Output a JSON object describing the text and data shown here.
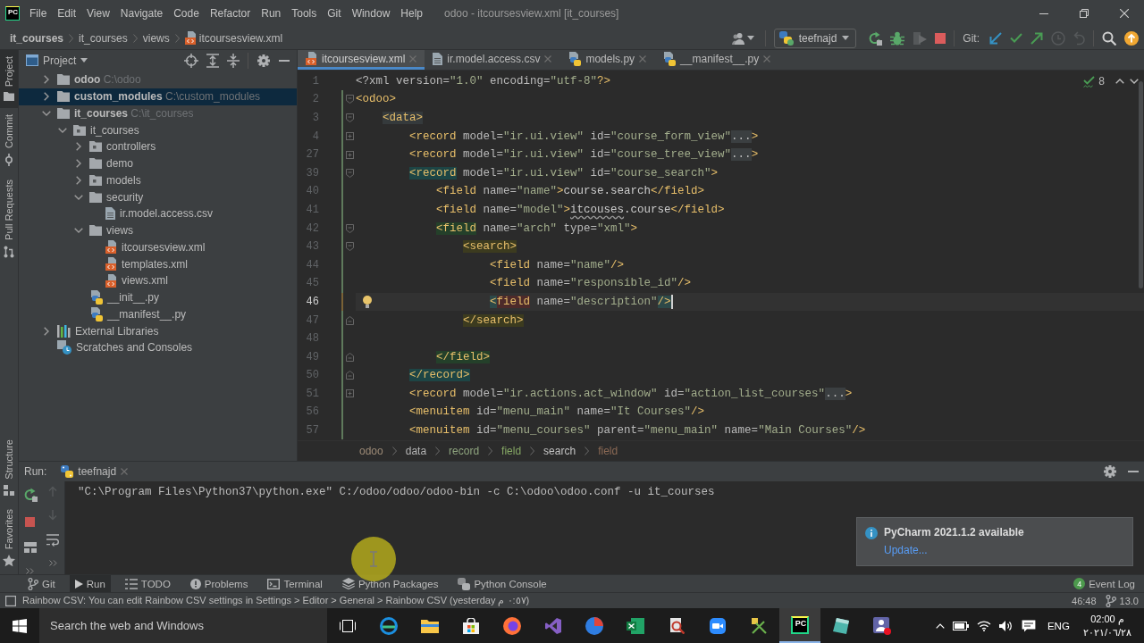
{
  "title_bar": {
    "logo": "PC",
    "menu": [
      "File",
      "Edit",
      "View",
      "Navigate",
      "Code",
      "Refactor",
      "Run",
      "Tools",
      "Git",
      "Window",
      "Help"
    ],
    "title": "odoo - itcoursesview.xml [it_courses]"
  },
  "nav_bar": {
    "breadcrumbs": [
      {
        "label": "it_courses",
        "kind": "root"
      },
      {
        "label": "it_courses",
        "kind": "folder"
      },
      {
        "label": "views",
        "kind": "folder"
      },
      {
        "label": "itcoursesview.xml",
        "kind": "xml"
      }
    ],
    "run_config": "teefnajd",
    "git_label": "Git:"
  },
  "tool_stripe": {
    "top": [
      {
        "label": "Project",
        "kind": "project",
        "selected": true
      },
      {
        "label": "Commit",
        "kind": "commit",
        "selected": false
      },
      {
        "label": "Pull Requests",
        "kind": "pulls",
        "selected": false
      }
    ],
    "bottom": [
      {
        "label": "Structure",
        "kind": "structure",
        "selected": false
      },
      {
        "label": "Favorites",
        "kind": "favorites",
        "selected": false
      }
    ]
  },
  "project_panel": {
    "title": "Project",
    "tree": [
      {
        "label": "odoo",
        "path": "C:\\odoo",
        "kind": "root",
        "expanded": false,
        "selected": false
      },
      {
        "label": "custom_modules",
        "path": "C:\\custom_modules",
        "kind": "root",
        "expanded": false,
        "selected": true
      },
      {
        "label": "it_courses",
        "path": "C:\\it_courses",
        "kind": "root",
        "expanded": true,
        "selected": false,
        "children": [
          {
            "label": "it_courses",
            "kind": "package",
            "expanded": true,
            "selected": false,
            "children": [
              {
                "label": "controllers",
                "kind": "package",
                "expanded": false,
                "selected": false
              },
              {
                "label": "demo",
                "kind": "folder",
                "expanded": false,
                "selected": false
              },
              {
                "label": "models",
                "kind": "package",
                "expanded": false,
                "selected": false
              },
              {
                "label": "security",
                "kind": "folder",
                "expanded": true,
                "selected": false,
                "children": [
                  {
                    "label": "ir.model.access.csv",
                    "kind": "csv",
                    "selected": false
                  }
                ]
              },
              {
                "label": "views",
                "kind": "folder",
                "expanded": true,
                "selected": false,
                "children": [
                  {
                    "label": "itcoursesview.xml",
                    "kind": "xml",
                    "selected": false
                  },
                  {
                    "label": "templates.xml",
                    "kind": "xml",
                    "selected": false
                  },
                  {
                    "label": "views.xml",
                    "kind": "xml",
                    "selected": false
                  }
                ]
              },
              {
                "label": "__init__.py",
                "kind": "python",
                "selected": false
              },
              {
                "label": "__manifest__.py",
                "kind": "python",
                "selected": false
              }
            ]
          }
        ]
      },
      {
        "label": "External Libraries",
        "kind": "libraries",
        "expanded": false,
        "selected": false
      },
      {
        "label": "Scratches and Consoles",
        "kind": "scratches",
        "selected": false
      }
    ]
  },
  "editor": {
    "tabs": [
      {
        "label": "itcoursesview.xml",
        "kind": "xml",
        "selected": true
      },
      {
        "label": "ir.model.access.csv",
        "kind": "csv",
        "selected": false
      },
      {
        "label": "models.py",
        "kind": "python",
        "selected": false
      },
      {
        "label": "__manifest__.py",
        "kind": "python",
        "selected": false
      }
    ],
    "inspections": "8",
    "lines": [
      {
        "number": "1",
        "changed": false,
        "block_end": false,
        "current": false,
        "tokens": [
          {
            "kind": "attr",
            "text": "<?xml version="
          },
          {
            "kind": "str",
            "text": "\"1.0\""
          },
          {
            "kind": "attr",
            "text": " encoding="
          },
          {
            "kind": "str",
            "text": "\"utf-8\""
          },
          {
            "kind": "tag",
            "text": "?>"
          }
        ]
      },
      {
        "number": "2",
        "changed": true,
        "expanded": true,
        "block_end": false,
        "current": false,
        "tokens": [
          {
            "kind": "tag",
            "text": "<odoo>"
          }
        ]
      },
      {
        "number": "3",
        "changed": true,
        "expanded": true,
        "block_end": false,
        "current": false,
        "tokens": [
          {
            "kind": "scope1",
            "text": "    <data>"
          }
        ]
      },
      {
        "number": "4",
        "changed": true,
        "expanded": false,
        "block_end": false,
        "current": false,
        "tokens": [
          {
            "kind": "tag",
            "text": "        <record"
          },
          {
            "kind": "attr",
            "text": " model="
          },
          {
            "kind": "str",
            "text": "\"ir.ui.view\""
          },
          {
            "kind": "attr",
            "text": " id="
          },
          {
            "kind": "str",
            "text": "\"course_form_view\""
          },
          {
            "kind": "folded",
            "text": "..."
          },
          {
            "kind": "tag",
            "text": ">"
          }
        ]
      },
      {
        "number": "27",
        "changed": true,
        "expanded": false,
        "block_end": false,
        "current": false,
        "tokens": [
          {
            "kind": "tag",
            "text": "        <record"
          },
          {
            "kind": "attr",
            "text": " model="
          },
          {
            "kind": "str",
            "text": "\"ir.ui.view\""
          },
          {
            "kind": "attr",
            "text": " id="
          },
          {
            "kind": "str",
            "text": "\"course_tree_view\""
          },
          {
            "kind": "folded",
            "text": "..."
          },
          {
            "kind": "tag",
            "text": ">"
          }
        ]
      },
      {
        "number": "39",
        "changed": true,
        "expanded": true,
        "block_end": false,
        "current": false,
        "tokens": [
          {
            "kind": "scope2",
            "text": "        <record"
          },
          {
            "kind": "attr",
            "text": " model="
          },
          {
            "kind": "str",
            "text": "\"ir.ui.view\""
          },
          {
            "kind": "attr",
            "text": " id="
          },
          {
            "kind": "str",
            "text": "\"course_search\""
          },
          {
            "kind": "tag",
            "text": ">"
          }
        ]
      },
      {
        "number": "40",
        "changed": true,
        "block_end": false,
        "current": false,
        "tokens": [
          {
            "kind": "tag",
            "text": "            <field"
          },
          {
            "kind": "attr",
            "text": " name="
          },
          {
            "kind": "str",
            "text": "\"name\""
          },
          {
            "kind": "tag",
            "text": ">"
          },
          {
            "kind": "text",
            "text": "course.search"
          },
          {
            "kind": "tag",
            "text": "</field>"
          }
        ]
      },
      {
        "number": "41",
        "changed": true,
        "block_end": false,
        "current": false,
        "tokens": [
          {
            "kind": "tag",
            "text": "            <field"
          },
          {
            "kind": "attr",
            "text": " name="
          },
          {
            "kind": "str",
            "text": "\"model\""
          },
          {
            "kind": "tag",
            "text": ">"
          },
          {
            "kind": "typo",
            "text": "itcouses"
          },
          {
            "kind": "text",
            "text": ".course"
          },
          {
            "kind": "tag",
            "text": "</field>"
          }
        ]
      },
      {
        "number": "42",
        "changed": true,
        "expanded": true,
        "block_end": false,
        "current": false,
        "tokens": [
          {
            "kind": "scope3",
            "text": "            <field"
          },
          {
            "kind": "attr",
            "text": " name="
          },
          {
            "kind": "str",
            "text": "\"arch\""
          },
          {
            "kind": "attr",
            "text": " type="
          },
          {
            "kind": "str",
            "text": "\"xml\""
          },
          {
            "kind": "tag",
            "text": ">"
          }
        ]
      },
      {
        "number": "43",
        "changed": true,
        "expanded": true,
        "block_end": false,
        "current": false,
        "tokens": [
          {
            "kind": "scope4",
            "text": "                <search>"
          }
        ]
      },
      {
        "number": "44",
        "changed": true,
        "block_end": false,
        "current": false,
        "tokens": [
          {
            "kind": "tag",
            "text": "                    <field"
          },
          {
            "kind": "attr",
            "text": " name="
          },
          {
            "kind": "str",
            "text": "\"name\""
          },
          {
            "kind": "tag",
            "text": "/>"
          }
        ]
      },
      {
        "number": "45",
        "changed": true,
        "block_end": false,
        "current": false,
        "tokens": [
          {
            "kind": "tag",
            "text": "                    <field"
          },
          {
            "kind": "attr",
            "text": " name="
          },
          {
            "kind": "str",
            "text": "\"responsible_id\""
          },
          {
            "kind": "tag",
            "text": "/>"
          }
        ]
      },
      {
        "number": "46",
        "changed": true,
        "block_end": false,
        "current": true,
        "tokens": [
          {
            "kind": "match",
            "text": "                    <"
          },
          {
            "kind": "error",
            "text": "field"
          },
          {
            "kind": "attr",
            "text": " name="
          },
          {
            "kind": "str",
            "text": "\"description\""
          },
          {
            "kind": "match",
            "text": "/>"
          }
        ]
      },
      {
        "number": "47",
        "changed": true,
        "block_end": true,
        "current": false,
        "tokens": [
          {
            "kind": "scope4",
            "text": "                </search>"
          }
        ]
      },
      {
        "number": "48",
        "changed": true,
        "block_end": false,
        "current": false
      },
      {
        "number": "49",
        "changed": true,
        "block_end": true,
        "current": false,
        "tokens": [
          {
            "kind": "scope3",
            "text": "            </field>"
          }
        ]
      },
      {
        "number": "50",
        "changed": true,
        "block_end": true,
        "current": false,
        "tokens": [
          {
            "kind": "scope2",
            "text": "        </record>"
          }
        ]
      },
      {
        "number": "51",
        "changed": true,
        "expanded": false,
        "block_end": false,
        "current": false,
        "tokens": [
          {
            "kind": "tag",
            "text": "        <record"
          },
          {
            "kind": "attr",
            "text": " model="
          },
          {
            "kind": "str",
            "text": "\"ir.actions.act_window\""
          },
          {
            "kind": "attr",
            "text": " id="
          },
          {
            "kind": "str",
            "text": "\"action_list_courses\""
          },
          {
            "kind": "folded",
            "text": "..."
          },
          {
            "kind": "tag",
            "text": ">"
          }
        ]
      },
      {
        "number": "56",
        "changed": true,
        "block_end": false,
        "current": false,
        "tokens": [
          {
            "kind": "tag",
            "text": "        <menuitem"
          },
          {
            "kind": "attr",
            "text": " id="
          },
          {
            "kind": "str",
            "text": "\"menu_main\""
          },
          {
            "kind": "attr",
            "text": " name="
          },
          {
            "kind": "str",
            "text": "\"It Courses\""
          },
          {
            "kind": "tag",
            "text": "/>"
          }
        ]
      },
      {
        "number": "57",
        "changed": true,
        "block_end": false,
        "current": false,
        "tokens": [
          {
            "kind": "tag",
            "text": "        <menuitem"
          },
          {
            "kind": "attr",
            "text": " id="
          },
          {
            "kind": "str",
            "text": "\"menu_courses\""
          },
          {
            "kind": "attr",
            "text": " parent="
          },
          {
            "kind": "str",
            "text": "\"menu_main\""
          },
          {
            "kind": "attr",
            "text": " name="
          },
          {
            "kind": "str",
            "text": "\"Main Courses\""
          },
          {
            "kind": "tag",
            "text": "/>"
          }
        ]
      }
    ],
    "breadcrumbs": [
      {
        "label": "odoo",
        "color": "#9c8a76"
      },
      {
        "label": "data",
        "color": "#b5b5b5"
      },
      {
        "label": "record",
        "color": "#8fa57f"
      },
      {
        "label": "field",
        "color": "#86a865"
      },
      {
        "label": "search",
        "color": "#c4c4c4"
      },
      {
        "label": "field",
        "color": "#8c6a55"
      }
    ]
  },
  "run_panel": {
    "label": "Run:",
    "tab": "teefnajd",
    "console": [
      "\"C:\\Program Files\\Python37\\python.exe\" C:/odoo/odoo/odoo-bin -c C:\\odoo\\odoo.conf -u it_courses"
    ]
  },
  "notification": {
    "title": "PyCharm 2021.1.2 available",
    "action": "Update..."
  },
  "tool_bar": {
    "items": [
      {
        "label": "Git",
        "kind": "git",
        "selected": false
      },
      {
        "label": "Run",
        "kind": "run",
        "selected": true
      },
      {
        "label": "TODO",
        "kind": "todo",
        "selected": false
      },
      {
        "label": "Problems",
        "kind": "problems",
        "selected": false
      },
      {
        "label": "Terminal",
        "kind": "terminal",
        "selected": false
      },
      {
        "label": "Python Packages",
        "kind": "packages",
        "selected": false
      },
      {
        "label": "Python Console",
        "kind": "console",
        "selected": false
      }
    ],
    "event_log": {
      "label": "Event Log",
      "count": "4"
    }
  },
  "status_bar": {
    "message": "Rainbow CSV: You can edit Rainbow CSV settings in Settings > Editor > General > Rainbow CSV (yesterday ٠:٥٧ م)",
    "position": "46:48",
    "branch": "13.0"
  },
  "taskbar": {
    "search": {
      "placeholder": "Search the web and Windows"
    },
    "apps": [
      {
        "kind": "taskview",
        "selected": false
      },
      {
        "kind": "edge",
        "selected": false
      },
      {
        "kind": "explorer",
        "selected": false
      },
      {
        "kind": "store",
        "selected": false
      },
      {
        "kind": "firefox",
        "selected": false
      },
      {
        "kind": "studio",
        "selected": false
      },
      {
        "kind": "disc",
        "selected": false
      },
      {
        "kind": "excel",
        "selected": false
      },
      {
        "kind": "magnifier",
        "selected": false
      },
      {
        "kind": "zoom",
        "selected": false
      },
      {
        "kind": "tools",
        "selected": false
      },
      {
        "kind": "pycharm",
        "label": "PC",
        "selected": true
      },
      {
        "kind": "notes",
        "selected": false
      },
      {
        "kind": "teams",
        "selected": false
      }
    ],
    "language": "ENG",
    "time": "02:00 م",
    "date": "٢٠٢١/٠٦/٢٨"
  }
}
